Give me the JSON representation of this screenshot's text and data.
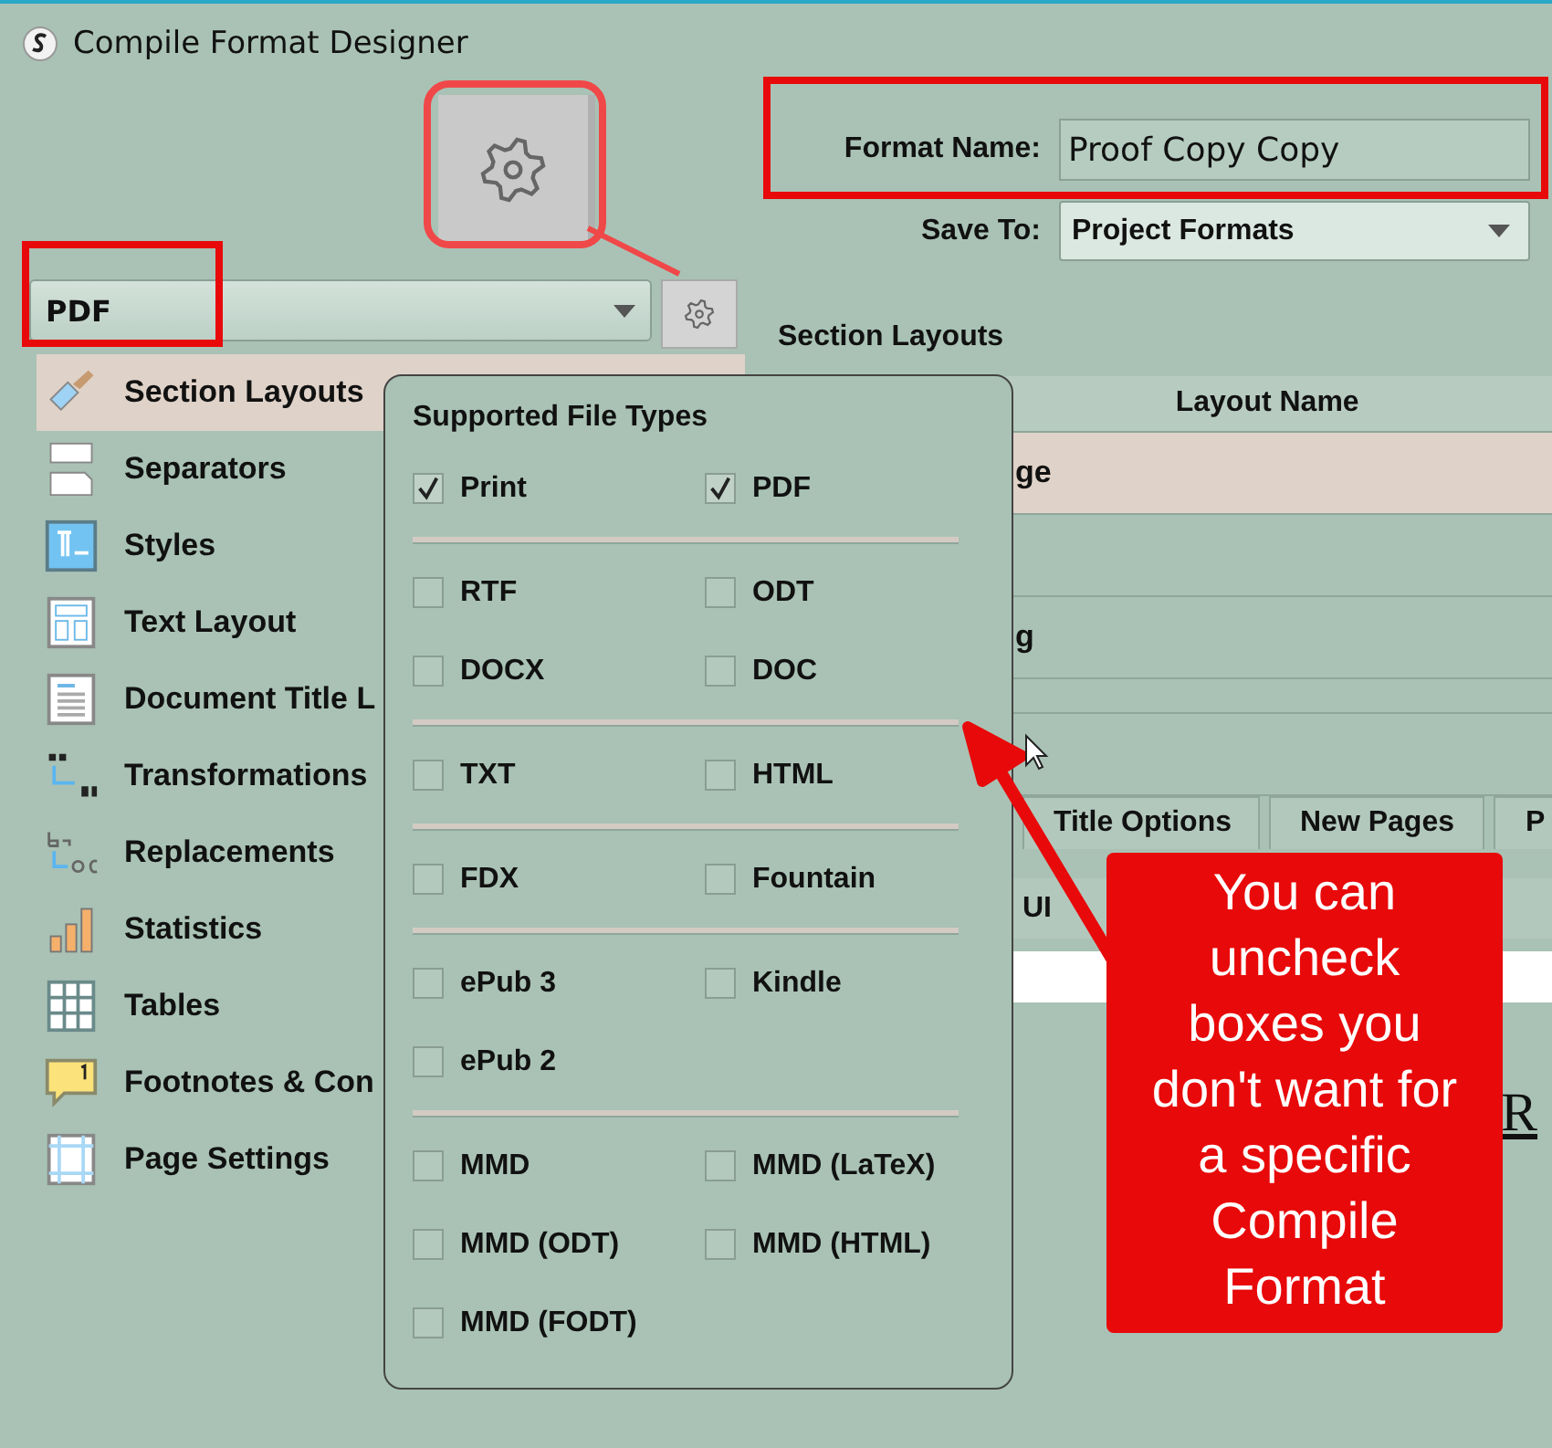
{
  "window": {
    "title": "Compile Format Designer"
  },
  "format_selector": {
    "value": "PDF"
  },
  "sidebar": {
    "items": [
      {
        "label": "Section Layouts",
        "selected": true
      },
      {
        "label": "Separators",
        "selected": false
      },
      {
        "label": "Styles",
        "selected": false
      },
      {
        "label": "Text Layout",
        "selected": false
      },
      {
        "label": "Document Title L",
        "selected": false
      },
      {
        "label": "Transformations",
        "selected": false
      },
      {
        "label": "Replacements",
        "selected": false
      },
      {
        "label": "Statistics",
        "selected": false
      },
      {
        "label": "Tables",
        "selected": false
      },
      {
        "label": "Footnotes & Con",
        "selected": false
      },
      {
        "label": "Page Settings",
        "selected": false
      }
    ]
  },
  "format_name": {
    "label": "Format Name:",
    "value": "Proof Copy Copy"
  },
  "save_to": {
    "label": "Save To:",
    "value": "Project Formats"
  },
  "section_layouts": {
    "title": "Section Layouts",
    "column": "Layout Name",
    "rows": [
      {
        "text": "ge",
        "selected": true
      },
      {
        "selected": false
      },
      {
        "text": "g",
        "selected": false
      },
      {
        "selected": false
      },
      {
        "selected": false
      }
    ]
  },
  "tabs": [
    {
      "label": "Title Options"
    },
    {
      "label": "New Pages"
    },
    {
      "label": "P"
    }
  ],
  "options_row": {
    "text": "UI"
  },
  "preview_text": "R",
  "popover": {
    "title": "Supported File Types",
    "groups": [
      [
        {
          "label": "Print",
          "checked": true
        },
        {
          "label": "PDF",
          "checked": true
        }
      ],
      [
        {
          "label": "RTF",
          "checked": false
        },
        {
          "label": "ODT",
          "checked": false
        },
        {
          "label": "DOCX",
          "checked": false
        },
        {
          "label": "DOC",
          "checked": false
        }
      ],
      [
        {
          "label": "TXT",
          "checked": false
        },
        {
          "label": "HTML",
          "checked": false
        }
      ],
      [
        {
          "label": "FDX",
          "checked": false
        },
        {
          "label": "Fountain",
          "checked": false
        }
      ],
      [
        {
          "label": "ePub 3",
          "checked": false
        },
        {
          "label": "Kindle",
          "checked": false
        },
        {
          "label": "ePub 2",
          "checked": false
        }
      ],
      [
        {
          "label": "MMD",
          "checked": false
        },
        {
          "label": "MMD (LaTeX)",
          "checked": false
        },
        {
          "label": "MMD (ODT)",
          "checked": false
        },
        {
          "label": "MMD (HTML)",
          "checked": false
        },
        {
          "label": "MMD (FODT)",
          "checked": false
        }
      ]
    ]
  },
  "annotation": {
    "callout": "You can\nuncheck\nboxes you\ndon't want for\na specific\nCompile\nFormat"
  }
}
